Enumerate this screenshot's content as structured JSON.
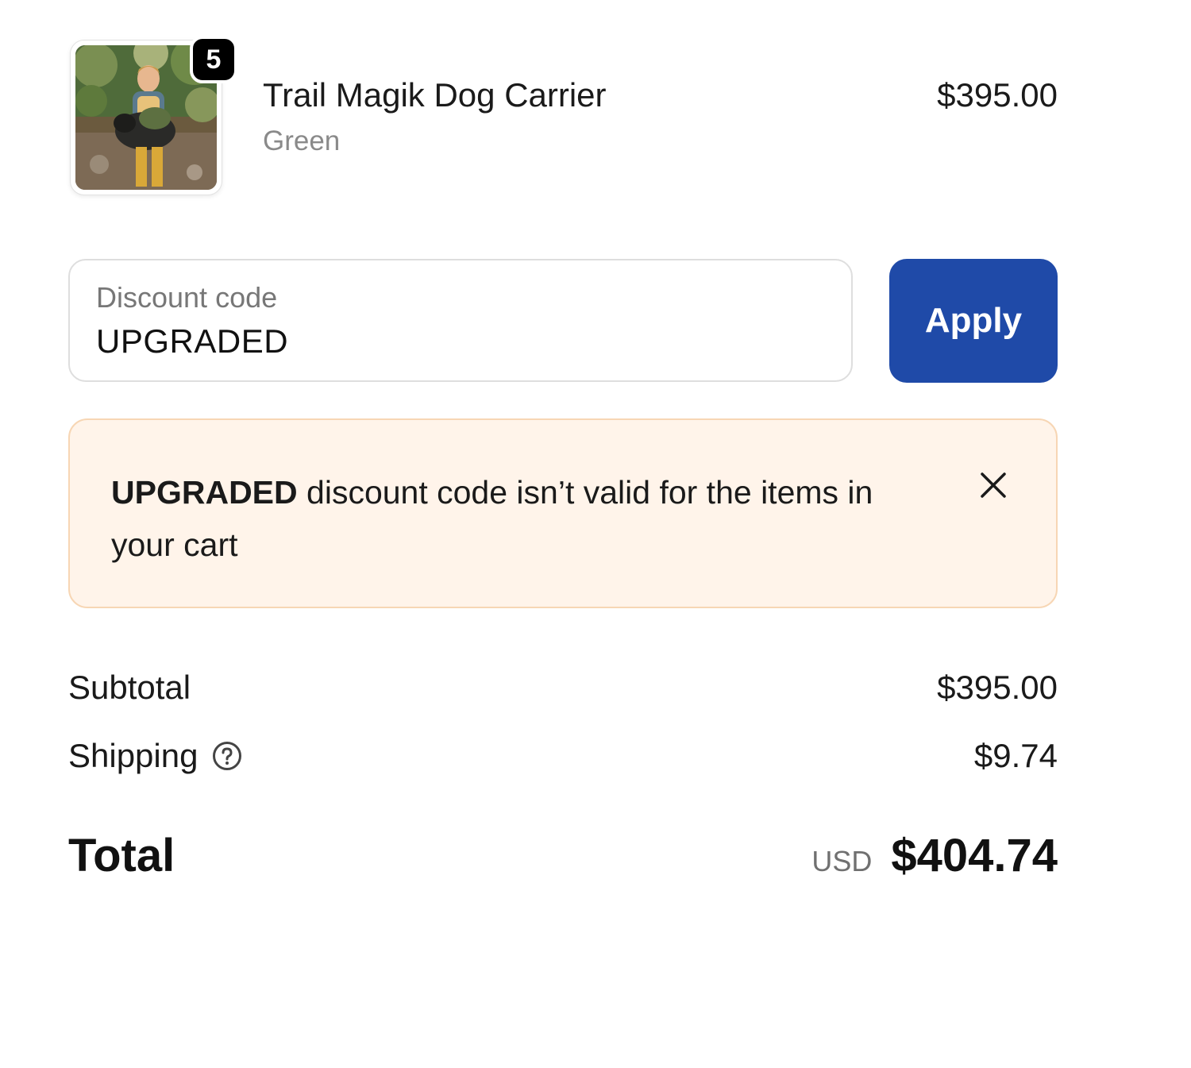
{
  "cart": {
    "item": {
      "quantity": "5",
      "name": "Trail Magik Dog Carrier",
      "variant": "Green",
      "price": "$395.00"
    }
  },
  "discount": {
    "label": "Discount code",
    "value": "UPGRADED",
    "apply_label": "Apply",
    "apply_color": "#1f4aa8"
  },
  "warning": {
    "code": "UPGRADED",
    "message": " discount code isn’t valid for the items in your cart",
    "background_color": "#fff4ea",
    "border_color": "#f7d6b4"
  },
  "summary": {
    "subtotal_label": "Subtotal",
    "subtotal_value": "$395.00",
    "shipping_label": "Shipping",
    "shipping_value": "$9.74",
    "total_label": "Total",
    "currency": "USD",
    "total_value": "$404.74"
  },
  "icons": {
    "shipping_help": "question-circle-icon",
    "dismiss": "close-icon"
  }
}
